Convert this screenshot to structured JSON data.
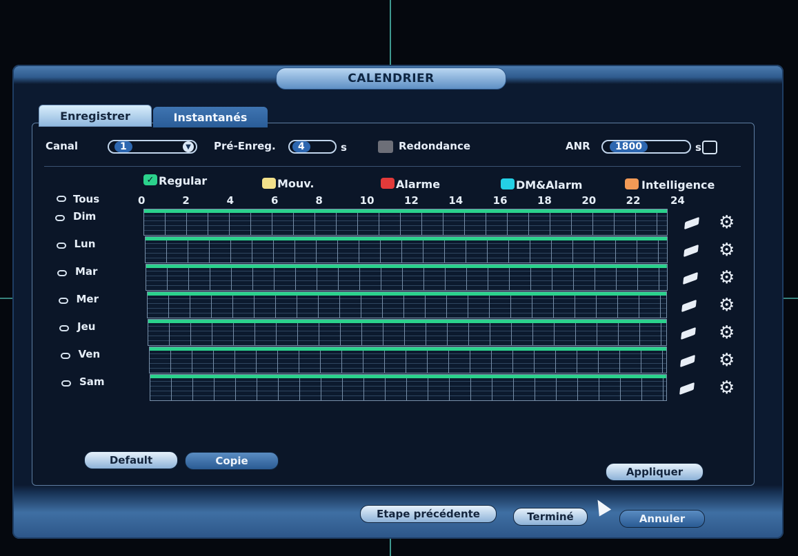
{
  "window": {
    "title": "CALENDRIER"
  },
  "tabs": [
    {
      "label": "Enregistrer"
    },
    {
      "label": "Instantanés"
    }
  ],
  "config": {
    "canal_label": "Canal",
    "canal_value": "1",
    "pre_label": "Pré-Enreg.",
    "pre_value": "4",
    "pre_unit": "s",
    "redondance_label": "Redondance",
    "anr_label": "ANR",
    "anr_value": "1800",
    "anr_unit": "s"
  },
  "legend": [
    {
      "label": "Regular",
      "color": "#2bd28c",
      "icon": "check-icon"
    },
    {
      "label": "Mouv.",
      "color": "#f2e08a"
    },
    {
      "label": "Alarme",
      "color": "#e23a3a"
    },
    {
      "label": "DM&Alarm",
      "color": "#24d0e6"
    },
    {
      "label": "Intelligence",
      "color": "#f29a56"
    }
  ],
  "hours": [
    "0",
    "2",
    "4",
    "6",
    "8",
    "10",
    "12",
    "14",
    "16",
    "18",
    "20",
    "22",
    "24"
  ],
  "all_label": "Tous",
  "days": [
    "Dim",
    "Lun",
    "Mar",
    "Mer",
    "Jeu",
    "Ven",
    "Sam"
  ],
  "schedule_fill": [
    1,
    1,
    1,
    1,
    1,
    1,
    1
  ],
  "row_icons": {
    "edit": "eraser-icon",
    "settings": "gear-icon"
  },
  "buttons": {
    "default": "Default",
    "copie": "Copie",
    "appliquer": "Appliquer",
    "back": "Etape précédente",
    "done": "Terminé",
    "cancel": "Annuler"
  }
}
